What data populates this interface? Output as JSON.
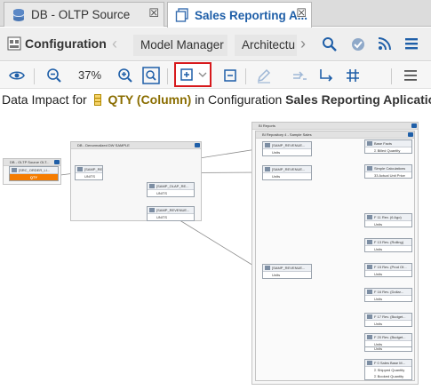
{
  "tabs": [
    {
      "label": "DB - OLTP Source",
      "close": "☒"
    },
    {
      "label": "Sales Reporting A...",
      "close": "☒"
    }
  ],
  "nav": {
    "configuration": "Configuration",
    "items": [
      "Model Manager",
      "Architectu"
    ]
  },
  "toolbar": {
    "zoom": "37%"
  },
  "title": {
    "prefix": "Data Impact for",
    "column": "QTY (Column)",
    "middle": "in Configuration",
    "config": "Sales Reporting Aplication"
  },
  "groups": {
    "oltp": "DB - OLTP Source OLT...",
    "dw": "DB - Denormalized DW SAMPLE",
    "bi": "BI Reports",
    "rep": "BI Repository 4 - Sample Sales"
  },
  "nodes": {
    "src": {
      "title": "[SRC_ORDER_LI...",
      "row": "QTY"
    },
    "dw1": {
      "title": "[SAMP_REVENUE...",
      "row": "UNITS"
    },
    "dw2": {
      "title": "[SAMP_OLAP_RE...",
      "row": "UNITS"
    },
    "dw3": {
      "title": "[SAMP_REVENUE...",
      "row": "UNITS"
    },
    "bi1": {
      "title": "[SAMP_REVENUE...",
      "row": "Units"
    },
    "bi2": {
      "title": "[SAMP_REVENUE...",
      "row": "Units"
    },
    "bi3": {
      "title": "[SAMP_REVENUE...",
      "row": "Units"
    },
    "r1": {
      "title": "Base Facts",
      "row": "Σ Billed Quantity"
    },
    "r2": {
      "title": "Simple Calculations",
      "row": "33 Actual Unit Price"
    },
    "r3": {
      "title": "F 11 Rev. (6 Ago)",
      "row": "Units"
    },
    "r4": {
      "title": "F 13 Rev. (Rolling)",
      "row": "Units"
    },
    "r5": {
      "title": "F 15 Rev. (Prod Of...",
      "row": "Units"
    },
    "r6": {
      "title": "F 16 Rev. (Dollar...",
      "row": "Units"
    },
    "r7": {
      "title": "F 17 Rev. (Budget...",
      "row": "Units"
    },
    "r8": {
      "title": "F 19 Rev. (Intimate...",
      "row": "Units"
    },
    "r9": {
      "title": "F 20 Rev. (Budget...",
      "row": "Units"
    },
    "r10": {
      "title": "F 0 Sales Base M...",
      "rows": [
        "Σ Shipped Quantity",
        "Σ Booked Quantity"
      ]
    }
  }
}
